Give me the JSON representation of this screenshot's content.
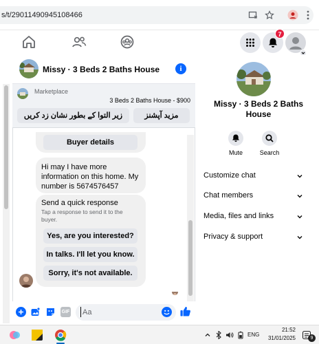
{
  "browser": {
    "url": "s/t/29011490945108466"
  },
  "nav": {
    "notification_count": "7"
  },
  "chat": {
    "title": "Missy · 3 Beds 2 Baths House",
    "banner": {
      "category": "Marketplace",
      "listing": "3 Beds 2 Baths House - $900",
      "more_options_label": "مزید آپشنز",
      "mark_sold_label": "زیر التوا کے بطور نشان زد کریں"
    },
    "buyer_details_label": "Buyer details",
    "message": "Hi may I have more information on this home. My number is 5674576457",
    "quick_response": {
      "title": "Send a quick response",
      "subtitle": "Tap a response to send it to the buyer.",
      "options": [
        "Yes, are you interested?",
        "In talks. I'll let you know.",
        "Sorry, it's not available."
      ]
    },
    "composer_placeholder": "Aa"
  },
  "details": {
    "title": "Missy · 3 Beds 2 Baths House",
    "mute_label": "Mute",
    "search_label": "Search",
    "menu": [
      "Customize chat",
      "Chat members",
      "Media, files and links",
      "Privacy & support"
    ]
  },
  "taskbar": {
    "language": "ENG",
    "time": "21:52",
    "date": "31/01/2025",
    "notification_count": "9"
  },
  "colors": {
    "accent": "#0866ff",
    "badge": "#e41e3f"
  }
}
